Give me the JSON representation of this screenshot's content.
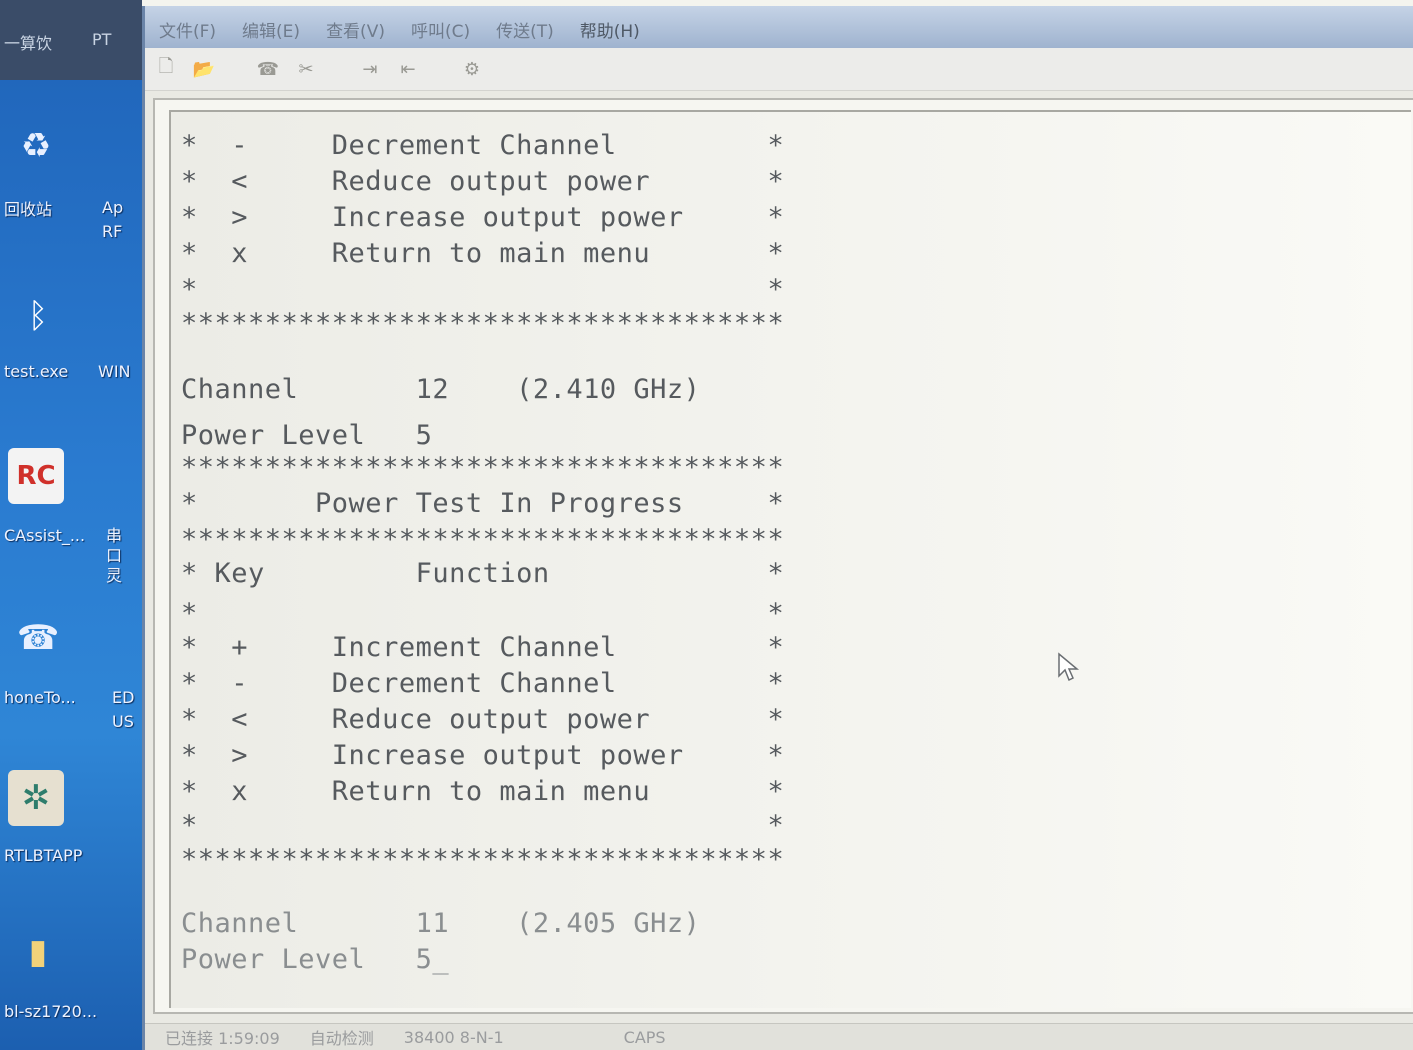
{
  "desktop": {
    "top_labels": [
      "一算饮",
      "PT"
    ],
    "icons": [
      {
        "label": "回收站",
        "icon": "recycle-bin-icon"
      },
      {
        "label": "Ap",
        "icon": "app-icon"
      },
      {
        "label": "RF",
        "icon": "app-icon"
      },
      {
        "label": "test.exe",
        "icon": "bluetooth-icon"
      },
      {
        "label": "WIN",
        "icon": "app-icon"
      },
      {
        "label": "CAssist_...",
        "icon": "rf-assist-icon"
      },
      {
        "label": "串口灵",
        "icon": "serial-icon"
      },
      {
        "label": "honeTo...",
        "icon": "phone-icon"
      },
      {
        "label": "ED",
        "icon": "app-icon"
      },
      {
        "label": "US",
        "icon": "app-icon"
      },
      {
        "label": "RTLBTAPP",
        "icon": "crab-icon"
      },
      {
        "label": "bl-sz1720...",
        "icon": "folder-icon"
      }
    ]
  },
  "window": {
    "menu": [
      "文件(F)",
      "编辑(E)",
      "查看(V)",
      "呼叫(C)",
      "传送(T)",
      "帮助(H)"
    ],
    "toolbar_icons": [
      "new-icon",
      "open-icon",
      "separator",
      "phone-icon",
      "disconnect-icon",
      "separator",
      "send-icon",
      "receive-icon",
      "separator",
      "properties-icon"
    ]
  },
  "terminal": {
    "lines": [
      "*  -     Decrement Channel         *",
      "*  <     Reduce output power       *",
      "*  >     Increase output power     *",
      "*  x     Return to main menu       *",
      "*                                  *",
      "************************************",
      "",
      "Channel       12    (2.410 GHz)",
      "Power Level   5",
      "************************************",
      "*       Power Test In Progress     *",
      "************************************",
      "* Key         Function             *",
      "*                                  *",
      "*  +     Increment Channel         *",
      "*  -     Decrement Channel         *",
      "*  <     Reduce output power       *",
      "*  >     Increase output power     *",
      "*  x     Return to main menu       *",
      "*                                  *",
      "************************************",
      "",
      "Channel       11    (2.405 GHz)",
      "Power Level   5_"
    ]
  },
  "statusbar": {
    "connection": "已连接 1:59:09",
    "detect": "自动检测",
    "baud": "38400 8-N-1",
    "caps": "CAPS"
  }
}
